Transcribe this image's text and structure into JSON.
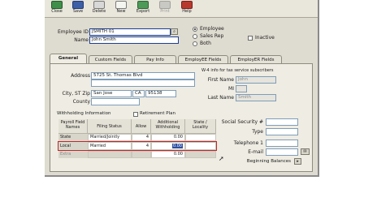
{
  "toolbar": {
    "buttons": [
      {
        "label": "Close",
        "icon": "close-icon"
      },
      {
        "label": "Save",
        "icon": "save-icon"
      },
      {
        "label": "Delete",
        "icon": "delete-icon"
      },
      {
        "label": "New",
        "icon": "new-icon"
      },
      {
        "label": "Export",
        "icon": "export-icon"
      },
      {
        "label": "Print",
        "icon": "print-icon"
      },
      {
        "label": "Help",
        "icon": "help-icon"
      }
    ]
  },
  "employee": {
    "id_label": "Employee ID",
    "id_value": "JSMITH 01",
    "name_label": "Name",
    "name_value": "John Smith",
    "type_options": [
      "Employee",
      "Sales Rep",
      "Both"
    ],
    "inactive_label": "Inactive"
  },
  "tabs": [
    "General",
    "Custom Fields",
    "Pay Info",
    "EmployEE Fields",
    "EmployER Fields"
  ],
  "general": {
    "address_label": "Address",
    "address_value": "5725 St. Thomas Blvd",
    "city_label": "City, ST Zip",
    "city_value": "San Jose",
    "state_value": "CA",
    "zip_value": "95138",
    "county_label": "County",
    "w4_title": "W-4 info for tax service subscribers",
    "first_name_label": "First Name",
    "first_name_value": "John",
    "mi_label": "MI",
    "last_name_label": "Last Name",
    "last_name_value": "Smith",
    "withholding_label": "Withholding Information",
    "retirement_label": "Retirement Plan",
    "ssn_label": "Social Security #",
    "type_label": "Type",
    "telephone_label": "Telephone 1",
    "email_label": "E-mail",
    "beginning_balances_label": "Beginning Balances"
  },
  "withholding_table": {
    "headers": [
      "Payroll Field Names",
      "Filing Status",
      "Allow",
      "Additional Withholding",
      "State / Locality"
    ],
    "rows": [
      {
        "name": "State",
        "status": "Married/Jointly",
        "allow": "4",
        "additional": "0.00",
        "locality": ""
      },
      {
        "name": "Local",
        "status": "Married",
        "allow": "4",
        "additional": "0.00",
        "locality": ""
      },
      {
        "name": "Extra",
        "status": "",
        "allow": "",
        "additional": "0.00",
        "locality": ""
      }
    ]
  },
  "colors": {
    "window_bg": "#dedbd0",
    "panel_bg": "#efece3",
    "selection_border": "#c0282d"
  }
}
